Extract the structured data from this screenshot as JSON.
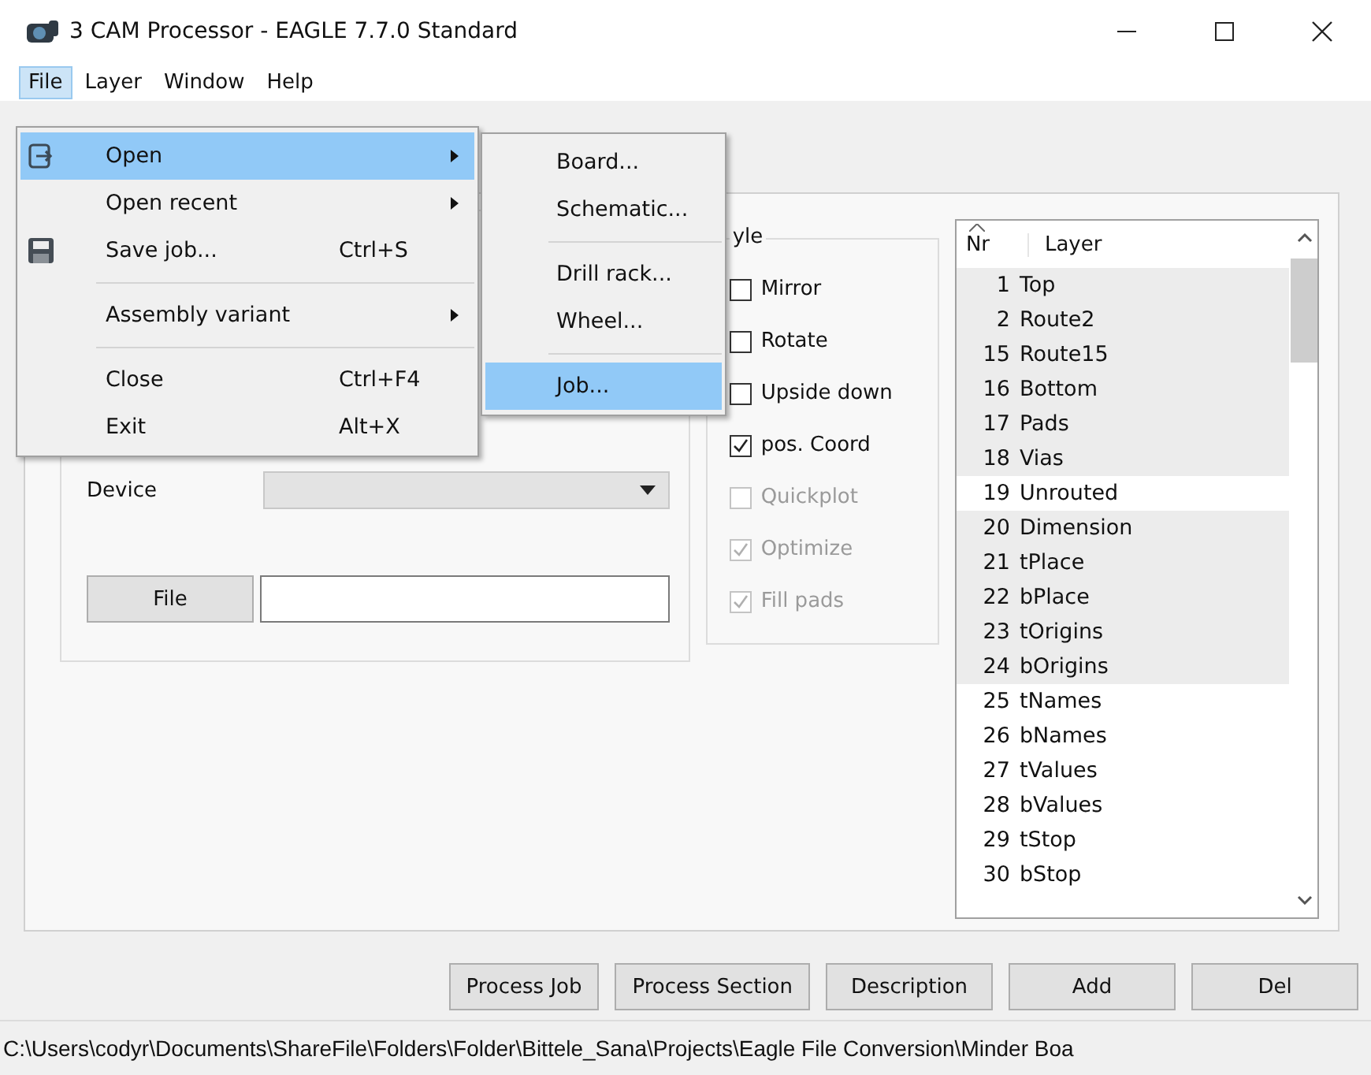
{
  "window": {
    "title": "3 CAM Processor - EAGLE 7.7.0 Standard"
  },
  "menu_bar": [
    {
      "label": "File",
      "selected": true
    },
    {
      "label": "Layer",
      "selected": false
    },
    {
      "label": "Window",
      "selected": false
    },
    {
      "label": "Help",
      "selected": false
    }
  ],
  "file_menu": [
    {
      "kind": "item",
      "label": "Open",
      "submenu": true,
      "selected": true
    },
    {
      "kind": "item",
      "label": "Open recent",
      "submenu": true,
      "selected": false
    },
    {
      "kind": "item",
      "label": "Save job...",
      "submenu": false,
      "shortcut": "Ctrl+S",
      "selected": false
    },
    {
      "kind": "separator"
    },
    {
      "kind": "item",
      "label": "Assembly variant",
      "submenu": true,
      "selected": false
    },
    {
      "kind": "separator"
    },
    {
      "kind": "item",
      "label": "Close",
      "submenu": false,
      "shortcut": "Ctrl+F4",
      "selected": false
    },
    {
      "kind": "item",
      "label": "Exit",
      "submenu": false,
      "shortcut": "Alt+X",
      "selected": false
    }
  ],
  "open_submenu": [
    {
      "kind": "item",
      "label": "Board...",
      "selected": false
    },
    {
      "kind": "item",
      "label": "Schematic...",
      "selected": false
    },
    {
      "kind": "separator"
    },
    {
      "kind": "item",
      "label": "Drill rack...",
      "selected": false
    },
    {
      "kind": "item",
      "label": "Wheel...",
      "selected": false
    },
    {
      "kind": "separator"
    },
    {
      "kind": "item",
      "label": "Job...",
      "selected": true
    }
  ],
  "output_group": {
    "device_label": "Device",
    "file_button": "File"
  },
  "style_group": {
    "title": "yle",
    "options": [
      {
        "label": "Mirror",
        "checked": false,
        "disabled": false
      },
      {
        "label": "Rotate",
        "checked": false,
        "disabled": false
      },
      {
        "label": "Upside down",
        "checked": false,
        "disabled": false
      },
      {
        "label": "pos. Coord",
        "checked": true,
        "disabled": false
      },
      {
        "label": "Quickplot",
        "checked": false,
        "disabled": true
      },
      {
        "label": "Optimize",
        "checked": true,
        "disabled": true
      },
      {
        "label": "Fill pads",
        "checked": true,
        "disabled": true
      }
    ]
  },
  "layer_list": {
    "columns": [
      "Nr",
      "Layer"
    ],
    "rows": [
      {
        "nr": "1",
        "name": "Top",
        "selected": true
      },
      {
        "nr": "2",
        "name": "Route2",
        "selected": true
      },
      {
        "nr": "15",
        "name": "Route15",
        "selected": true
      },
      {
        "nr": "16",
        "name": "Bottom",
        "selected": true
      },
      {
        "nr": "17",
        "name": "Pads",
        "selected": true
      },
      {
        "nr": "18",
        "name": "Vias",
        "selected": true
      },
      {
        "nr": "19",
        "name": "Unrouted",
        "selected": false
      },
      {
        "nr": "20",
        "name": "Dimension",
        "selected": true
      },
      {
        "nr": "21",
        "name": "tPlace",
        "selected": true
      },
      {
        "nr": "22",
        "name": "bPlace",
        "selected": true
      },
      {
        "nr": "23",
        "name": "tOrigins",
        "selected": true
      },
      {
        "nr": "24",
        "name": "bOrigins",
        "selected": true
      },
      {
        "nr": "25",
        "name": "tNames",
        "selected": false
      },
      {
        "nr": "26",
        "name": "bNames",
        "selected": false
      },
      {
        "nr": "27",
        "name": "tValues",
        "selected": false
      },
      {
        "nr": "28",
        "name": "bValues",
        "selected": false
      },
      {
        "nr": "29",
        "name": "tStop",
        "selected": false
      },
      {
        "nr": "30",
        "name": "bStop",
        "selected": false
      }
    ]
  },
  "buttons": [
    "Process Job",
    "Process Section",
    "Description",
    "Add",
    "Del"
  ],
  "status_bar": "C:\\Users\\codyr\\Documents\\ShareFile\\Folders\\Folder\\Bittele_Sana\\Projects\\Eagle File Conversion\\Minder Boa"
}
